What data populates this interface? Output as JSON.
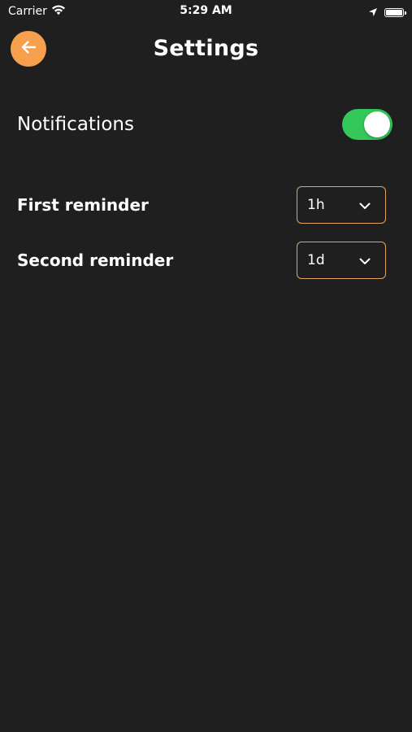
{
  "status_bar": {
    "carrier": "Carrier",
    "time": "5:29 AM",
    "icons": [
      "wifi-icon",
      "location-arrow-icon",
      "battery-icon"
    ]
  },
  "header": {
    "title": "Settings",
    "back_icon": "arrow-left-icon"
  },
  "notifications": {
    "label": "Notifications",
    "enabled": true
  },
  "reminders": {
    "first": {
      "label": "First reminder",
      "value": "1h"
    },
    "second": {
      "label": "Second reminder",
      "value": "1d"
    }
  },
  "colors": {
    "background": "#1f1f1f",
    "accent": "#f6a04d",
    "select_border": "#e3a55f",
    "toggle_on": "#34c759",
    "text": "#ffffff"
  }
}
